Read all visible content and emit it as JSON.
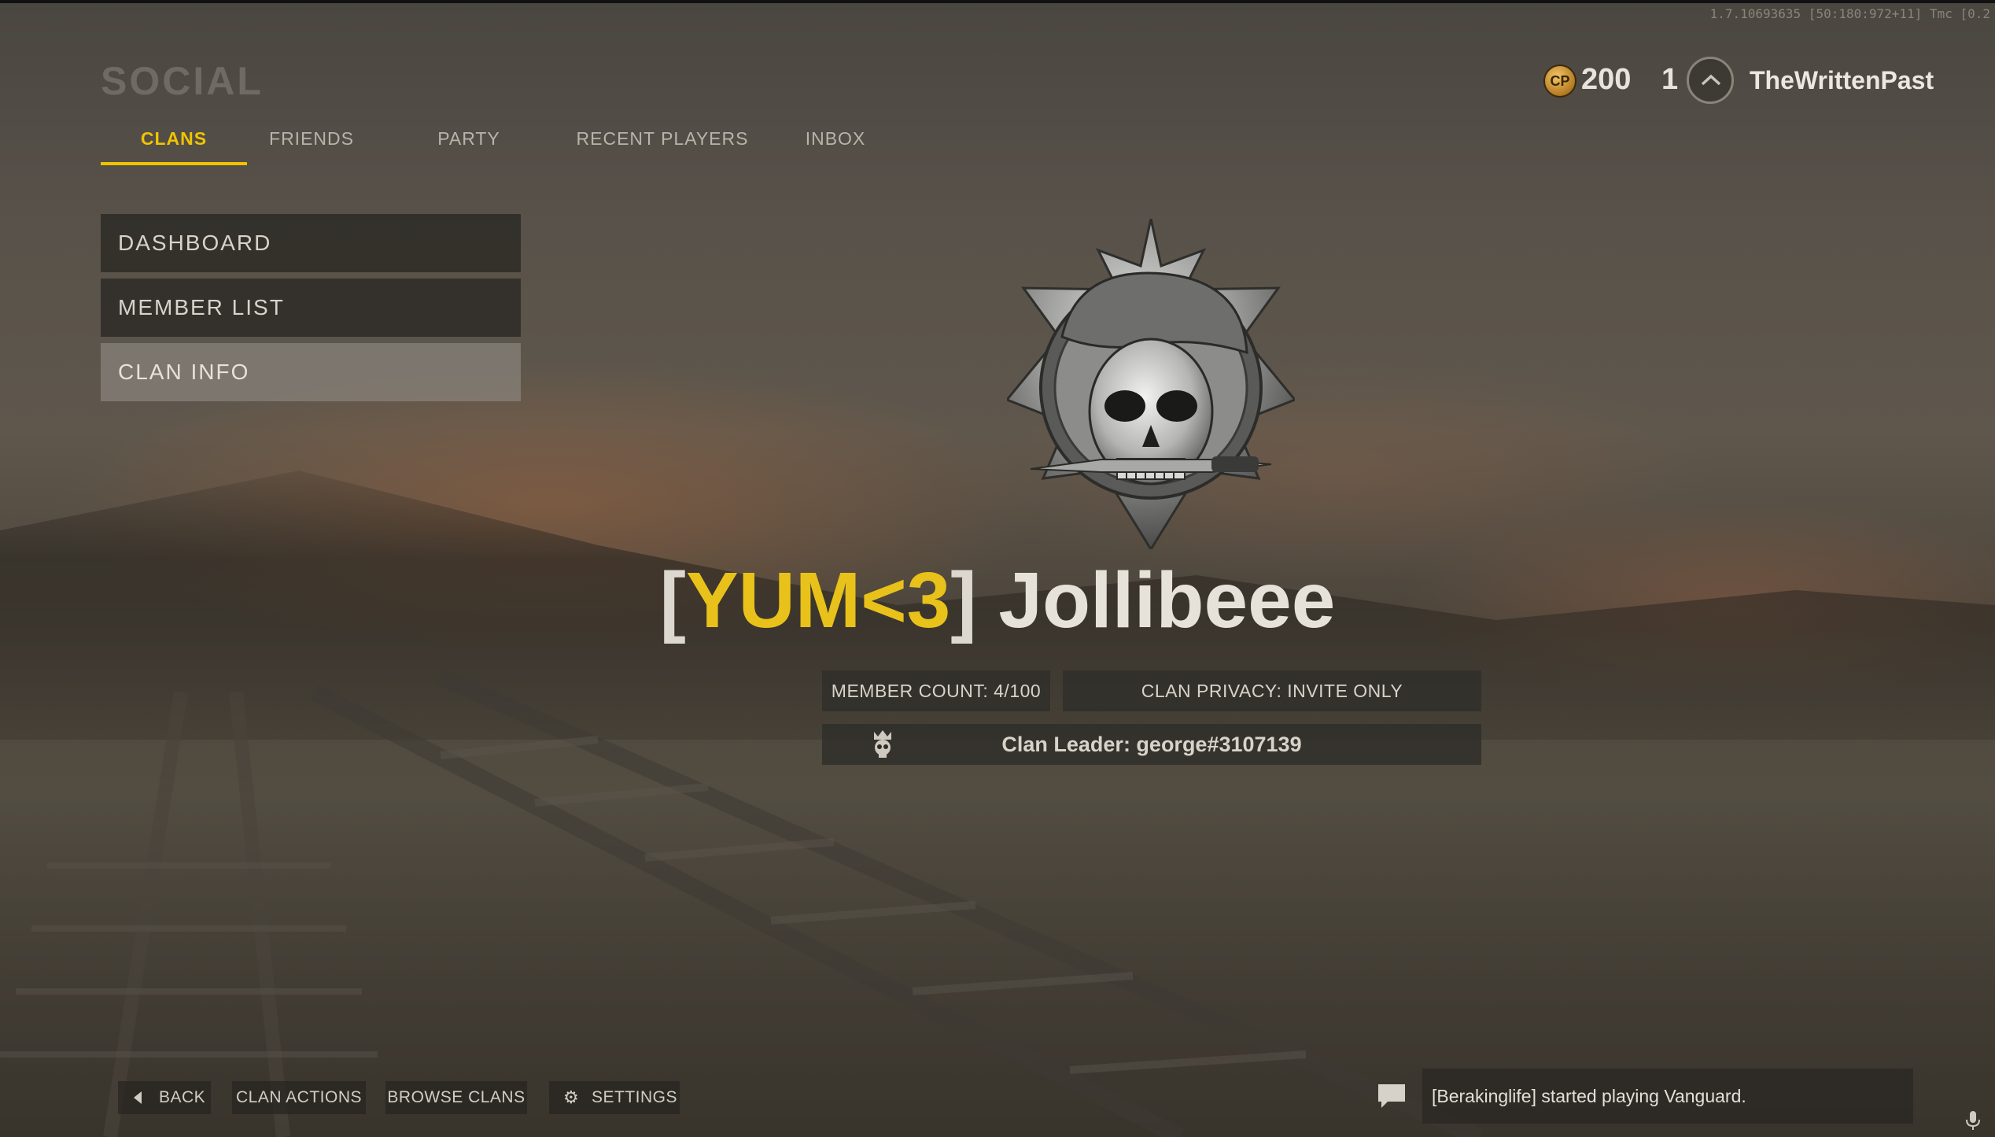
{
  "version_text": "1.7.10693635 [50:180:972+11] Tmc [0.2",
  "header": {
    "title": "SOCIAL",
    "tabs": [
      {
        "label": "CLANS",
        "active": true
      },
      {
        "label": "FRIENDS",
        "active": false
      },
      {
        "label": "PARTY",
        "active": false
      },
      {
        "label": "RECENT PLAYERS",
        "active": false
      },
      {
        "label": "INBOX",
        "active": false
      }
    ]
  },
  "player": {
    "cp_icon_text": "CP",
    "cp_amount": "200",
    "level": "1",
    "username": "TheWrittenPast"
  },
  "sidebar": {
    "items": [
      {
        "label": "DASHBOARD",
        "selected": false
      },
      {
        "label": "MEMBER LIST",
        "selected": false
      },
      {
        "label": "CLAN INFO",
        "selected": true
      }
    ]
  },
  "clan": {
    "bracket_open": "[",
    "tag": "YUM<3",
    "bracket_close": "]",
    "name": "Jollibeee",
    "member_count": "MEMBER COUNT: 4/100",
    "privacy": "CLAN PRIVACY: INVITE ONLY",
    "leader": "Clan Leader: george#3107139",
    "emblem_icon": "skull-beret-emblem-icon"
  },
  "footer": {
    "back": "BACK",
    "clan_actions": "CLAN ACTIONS",
    "browse_clans": "BROWSE CLANS",
    "settings": "SETTINGS"
  },
  "notification": {
    "text": "[Berakinglife] started playing Vanguard."
  },
  "colors": {
    "accent": "#f0c400",
    "clan_tag": "#e8c21a"
  }
}
